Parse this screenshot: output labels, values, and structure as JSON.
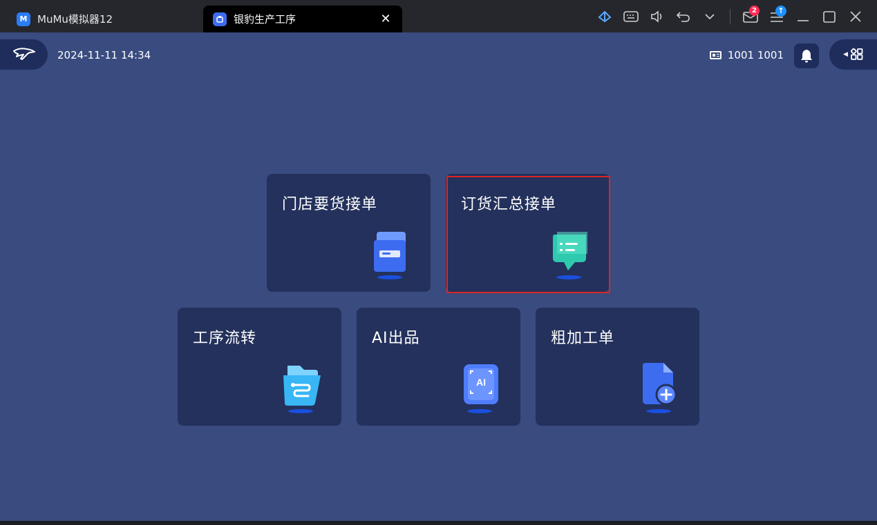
{
  "emulator": {
    "home_tab_label": "MuMu模拟器12",
    "active_tab_label": "银豹生产工序",
    "mail_badge": "2",
    "update_badge": "↑"
  },
  "header": {
    "datetime": "2024-11-11 14:34",
    "user": "1001 1001"
  },
  "menu": {
    "items": [
      {
        "label": "门店要货接单",
        "icon": "store-order-icon",
        "selected": false
      },
      {
        "label": "订货汇总接单",
        "icon": "order-summary-icon",
        "selected": true
      },
      {
        "label": "工序流转",
        "icon": "process-flow-icon",
        "selected": false
      },
      {
        "label": "AI出品",
        "icon": "ai-output-icon",
        "selected": false
      },
      {
        "label": "粗加工单",
        "icon": "rough-processing-icon",
        "selected": false
      }
    ]
  },
  "colors": {
    "screen_bg": "#394b7f",
    "card_bg": "#23315c",
    "highlight": "#e02323"
  }
}
